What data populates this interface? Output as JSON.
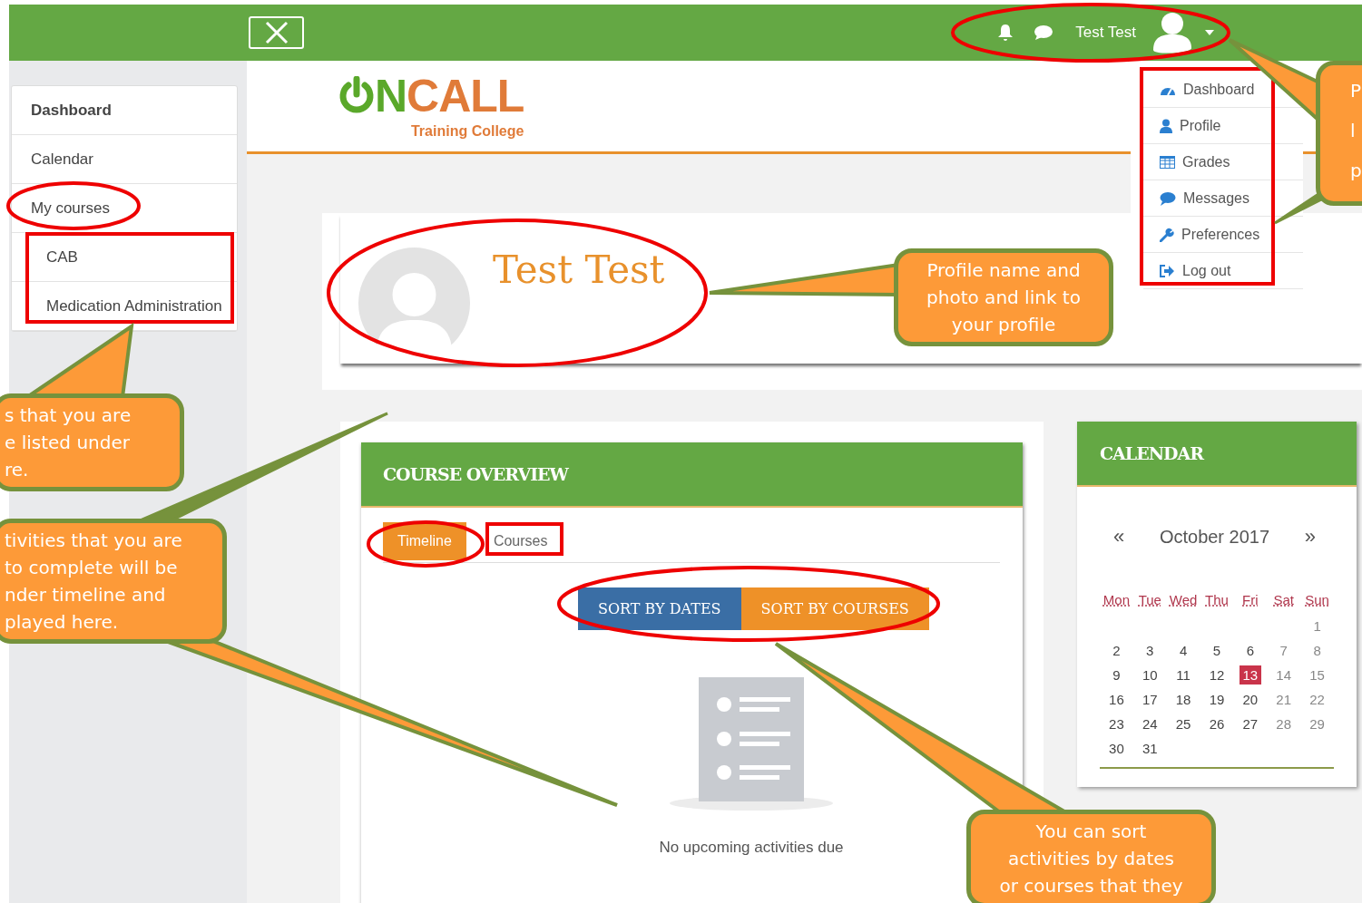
{
  "top_bar": {
    "user_name": "Test Test"
  },
  "sidebar": {
    "items": [
      {
        "label": "Dashboard",
        "selected": true
      },
      {
        "label": "Calendar",
        "selected": false
      },
      {
        "label": "My courses",
        "selected": false,
        "children": [
          {
            "label": "CAB",
            "selected": false
          },
          {
            "label": "Medication Administration",
            "selected": false
          }
        ]
      }
    ]
  },
  "logo": {
    "name": "NCALL",
    "tagline": "Training College"
  },
  "user_menu": {
    "items": [
      {
        "kind": "dashboard",
        "label": "Dashboard"
      },
      {
        "kind": "profile",
        "label": "Profile"
      },
      {
        "kind": "grades",
        "label": "Grades"
      },
      {
        "kind": "messages",
        "label": "Messages"
      },
      {
        "kind": "preferences",
        "label": "Preferences"
      },
      {
        "kind": "logout",
        "label": "Log out"
      }
    ]
  },
  "profile": {
    "name": "Test Test"
  },
  "course_overview": {
    "title": "COURSE OVERVIEW",
    "tabs": [
      {
        "label": "Timeline",
        "selected": true
      },
      {
        "label": "Courses",
        "selected": false
      }
    ],
    "sort_buttons": [
      {
        "label": "SORT BY DATES",
        "color": "#3a6ea5"
      },
      {
        "label": "SORT BY COURSES",
        "color": "#ee9128"
      }
    ],
    "empty_message": "No upcoming activities due"
  },
  "calendar": {
    "title": "CALENDAR",
    "prev": "«",
    "month": "October 2017",
    "next": "»",
    "weekdays": [
      "Mon",
      "Tue",
      "Wed",
      "Thu",
      "Fri",
      "Sat",
      "Sun"
    ],
    "weeks": [
      [
        {
          "day": "1",
          "today": false
        }
      ],
      [
        {
          "day": "2",
          "today": false
        },
        {
          "day": "3",
          "today": false
        },
        {
          "day": "4",
          "today": false
        },
        {
          "day": "5",
          "today": false
        },
        {
          "day": "6",
          "today": false
        },
        {
          "day": "7",
          "today": false
        },
        {
          "day": "8",
          "today": false
        }
      ],
      [
        {
          "day": "9",
          "today": false
        },
        {
          "day": "10",
          "today": false
        },
        {
          "day": "11",
          "today": false
        },
        {
          "day": "12",
          "today": false
        },
        {
          "day": "13",
          "today": true
        },
        {
          "day": "14",
          "today": false
        },
        {
          "day": "15",
          "today": false
        }
      ],
      [
        {
          "day": "16",
          "today": false
        },
        {
          "day": "17",
          "today": false
        },
        {
          "day": "18",
          "today": false
        },
        {
          "day": "19",
          "today": false
        },
        {
          "day": "20",
          "today": false
        },
        {
          "day": "21",
          "today": false
        },
        {
          "day": "22",
          "today": false
        }
      ],
      [
        {
          "day": "23",
          "today": false
        },
        {
          "day": "24",
          "today": false
        },
        {
          "day": "25",
          "today": false
        },
        {
          "day": "26",
          "today": false
        },
        {
          "day": "27",
          "today": false
        },
        {
          "day": "28",
          "today": false
        },
        {
          "day": "29",
          "today": false
        }
      ],
      [
        {
          "day": "30",
          "today": false
        },
        {
          "day": "31",
          "today": false
        }
      ]
    ]
  },
  "callouts": [
    {
      "lines": [
        "P",
        "l",
        "p"
      ]
    },
    {
      "lines": [
        "s that you are",
        "e listed under",
        "re."
      ]
    },
    {
      "lines": [
        "tivities that you are",
        "to complete will be",
        "nder timeline and",
        "played here."
      ]
    },
    {
      "lines": [
        "Profile name and",
        "photo and link to",
        "your profile"
      ]
    },
    {
      "lines": [
        "You can sort",
        "activities by dates",
        "or courses that they"
      ]
    }
  ]
}
